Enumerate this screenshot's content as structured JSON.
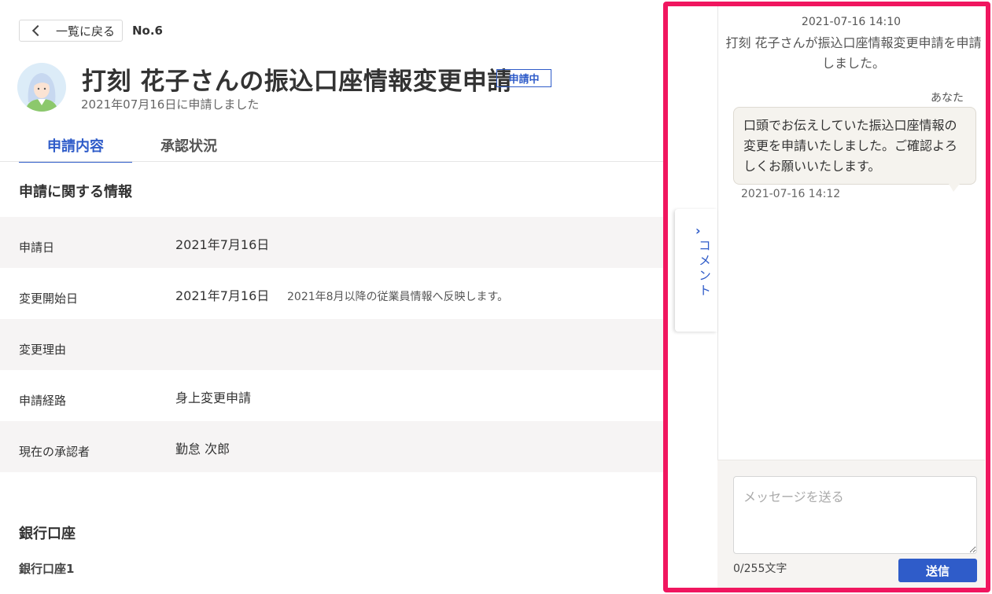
{
  "header": {
    "back_label": "一覧に戻る",
    "number": "No.6",
    "title": "打刻 花子さんの振込口座情報変更申請",
    "status": "申請中",
    "subtitle": "2021年07月16日に申請しました"
  },
  "tabs": [
    {
      "label": "申請内容",
      "active": true
    },
    {
      "label": "承認状況",
      "active": false
    }
  ],
  "section": {
    "title": "申請に関する情報",
    "rows": [
      {
        "label": "申請日",
        "value": "2021年7月16日",
        "note": ""
      },
      {
        "label": "変更開始日",
        "value": "2021年7月16日",
        "note": "2021年8月以降の従業員情報へ反映します。"
      },
      {
        "label": "変更理由",
        "value": "",
        "note": ""
      },
      {
        "label": "申請経路",
        "value": "身上変更申請",
        "note": ""
      },
      {
        "label": "現在の承認者",
        "value": "勤怠 次郎",
        "note": ""
      }
    ]
  },
  "bank": {
    "title": "銀行口座",
    "subtitle": "銀行口座1"
  },
  "comment_tab": {
    "label": "コメント",
    "icon": "chevron-right-icon"
  },
  "comments": {
    "system_time": "2021-07-16 14:10",
    "system_message": "打刻 花子さんが振込口座情報変更申請を申請しました。",
    "sender": "あなた",
    "message": "口頭でお伝えしていた振込口座情報の変更を申請いたしました。ご確認よろしくお願いいたします。",
    "message_time": "2021-07-16 14:12",
    "input_placeholder": "メッセージを送る",
    "char_count": "0/255文字",
    "send_label": "送信"
  },
  "colors": {
    "accent": "#2f5cc9",
    "highlight": "#f0165f",
    "row_shade": "#f6f4f4"
  }
}
